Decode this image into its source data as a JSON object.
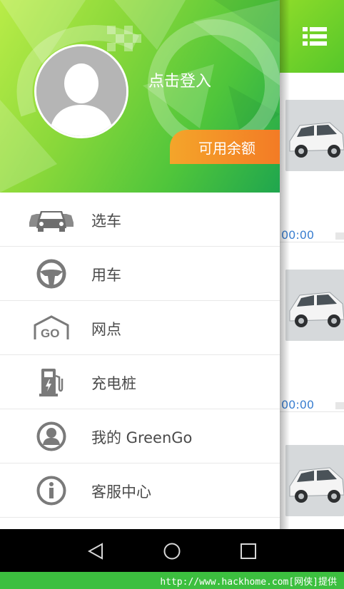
{
  "drawer": {
    "login_label": "点击登入",
    "balance_label": "可用余额",
    "menu": [
      {
        "label": "选车",
        "icon": "cars-icon"
      },
      {
        "label": "用车",
        "icon": "steering-wheel-icon"
      },
      {
        "label": "网点",
        "icon": "go-garage-icon"
      },
      {
        "label": "充电桩",
        "icon": "charging-station-icon"
      },
      {
        "label": "我的 GreenGo",
        "icon": "user-profile-icon"
      },
      {
        "label": "客服中心",
        "icon": "info-icon"
      }
    ]
  },
  "background_app": {
    "cards": [
      {
        "time": "00:00"
      },
      {
        "time": "00:00"
      }
    ]
  },
  "watermark": {
    "text": "http://www.hackhome.com[网侠]提供"
  },
  "colors": {
    "brand_green": "#4fc53b",
    "balance_orange": "#f37b25",
    "icon_gray": "#7a7a7a"
  }
}
